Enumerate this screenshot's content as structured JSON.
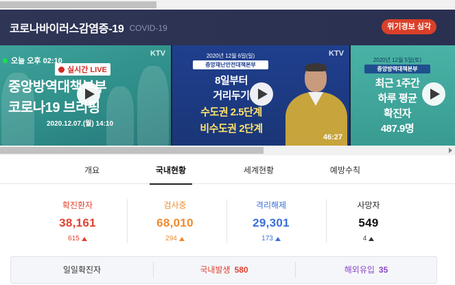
{
  "header": {
    "title": "코로나바이러스감염증-19",
    "subtitle": "COVID-19",
    "alert_label": "위기경보 심각"
  },
  "videos": [
    {
      "live_time": "오늘 오후 02:10",
      "live_badge": "실시간 LIVE",
      "channel": "KTV",
      "line1": "중앙방역대책본부",
      "line2": "코로나19 브리핑",
      "date": "2020.12.07.(월) 14:10"
    },
    {
      "channel": "KTV",
      "date_label": "2020년 12월 6일(일)",
      "dept": "중앙재난안전대책본부",
      "lines": [
        "8일부터",
        "거리두기",
        "수도권 2.5단계",
        "비수도권 2단계"
      ],
      "duration": "46:27"
    },
    {
      "date_label": "2020년 12월 5일(토)",
      "dept": "중앙방역대책본부",
      "lines": [
        "최근 1주간",
        "하루 평균",
        "확진자",
        "487.9명"
      ]
    }
  ],
  "tabs": [
    "개요",
    "국내현황",
    "세계현황",
    "예방수칙"
  ],
  "active_tab": "국내현황",
  "stats": [
    {
      "label": "확진환자",
      "value": "38,161",
      "delta": "615",
      "color": "#e0412f"
    },
    {
      "label": "검사중",
      "value": "68,010",
      "delta": "294",
      "color": "#ee8a2f"
    },
    {
      "label": "격리해제",
      "value": "29,301",
      "delta": "173",
      "color": "#3a6fd8"
    },
    {
      "label": "사망자",
      "value": "549",
      "delta": "4",
      "color": "#222222"
    }
  ],
  "daily": {
    "label": "일일확진자",
    "domestic_label": "국내발생",
    "domestic_value": "580",
    "overseas_label": "해외유입",
    "overseas_value": "35"
  },
  "colors": {
    "header_bg": "#2e3555",
    "alert": "#d9402a",
    "domestic": "#e0412f",
    "overseas": "#8a45c4"
  }
}
